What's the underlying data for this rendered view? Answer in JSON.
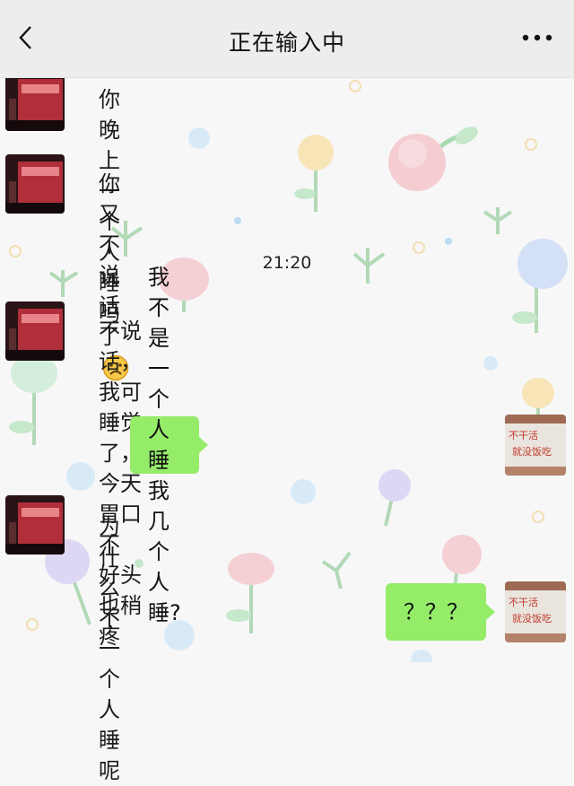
{
  "header": {
    "title": "正在输入中",
    "back_icon": "chevron-left-icon",
    "more_icon": "more-dots-icon"
  },
  "messages": [
    {
      "side": "left",
      "text": "你晚上一个人睡吗"
    },
    {
      "side": "left",
      "text": "你又不说话了",
      "emoji": "sad-face-emoji"
    },
    {
      "side": "left",
      "line1": "不说话，我可睡觉了，今天胃口不",
      "line2": "好头也稍疼"
    },
    {
      "side": "right",
      "text": "我不是一个人睡 我几个人睡?"
    },
    {
      "side": "left",
      "text": "为什么不一个人睡呢"
    },
    {
      "side": "right",
      "text": "？？？"
    }
  ],
  "timestamp": "21:20",
  "avatars": {
    "left": "red-storefront-avatar",
    "right": "white-wall-red-letters-avatar",
    "right_sign_text": [
      "不干活",
      "就没饭吃"
    ]
  },
  "colors": {
    "header_bg": "#ededed",
    "bubble_green": "#95ec69",
    "wall_bg": "#f7f7f8"
  }
}
